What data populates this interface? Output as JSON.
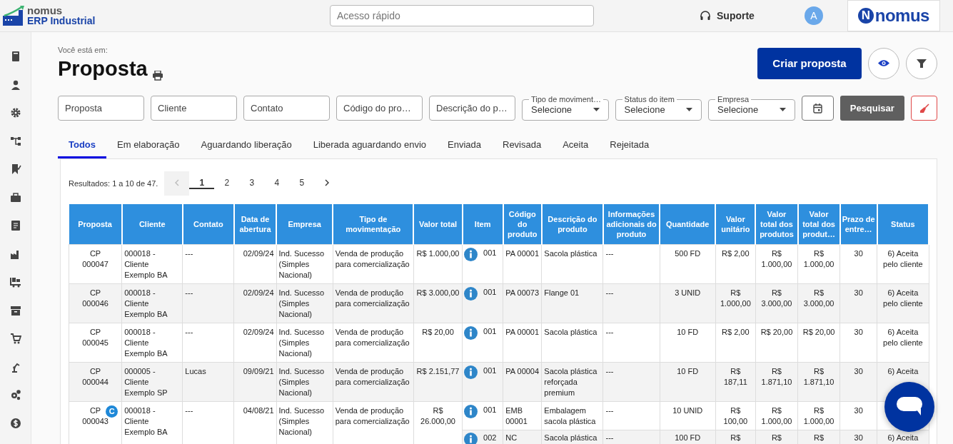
{
  "header": {
    "logo_line1": "nomus",
    "logo_line2": "ERP Industrial",
    "quick_access": {
      "placeholder": "Acesso rápido"
    },
    "support": "Suporte",
    "avatar": "A",
    "brand_mark": "N",
    "brand_name": "nomus"
  },
  "page": {
    "breadcrumb": "Você está em:",
    "title": "Proposta",
    "create_button": "Criar proposta"
  },
  "filters": [
    {
      "kind": "text",
      "placeholder": "Proposta"
    },
    {
      "kind": "text",
      "placeholder": "Cliente"
    },
    {
      "kind": "text",
      "placeholder": "Contato"
    },
    {
      "kind": "text",
      "placeholder": "Código do pro…"
    },
    {
      "kind": "text",
      "placeholder": "Descrição do p…"
    },
    {
      "kind": "select",
      "label": "Tipo de moviment…",
      "value": "Selecione"
    },
    {
      "kind": "select",
      "label": "Status do item",
      "value": "Selecione"
    },
    {
      "kind": "select",
      "label": "Empresa",
      "value": "Selecione"
    }
  ],
  "search_button": "Pesquisar",
  "tabs": [
    {
      "label": "Todos",
      "selected": true
    },
    {
      "label": "Em elaboração",
      "selected": false
    },
    {
      "label": "Aguardando liberação",
      "selected": false
    },
    {
      "label": "Liberada aguardando envio",
      "selected": false
    },
    {
      "label": "Enviada",
      "selected": false
    },
    {
      "label": "Revisada",
      "selected": false
    },
    {
      "label": "Aceita",
      "selected": false
    },
    {
      "label": "Rejeitada",
      "selected": false
    }
  ],
  "results": "Resultados: 1 a 10 de 47.",
  "pagination": {
    "prev_disabled": true,
    "pages": [
      {
        "label": "1",
        "selected": true
      },
      {
        "label": "2",
        "selected": false
      },
      {
        "label": "3",
        "selected": false
      },
      {
        "label": "4",
        "selected": false
      },
      {
        "label": "5",
        "selected": false
      }
    ]
  },
  "table": {
    "columns": [
      "Proposta",
      "Cliente",
      "Contato",
      "Data de abertura",
      "Empresa",
      "Tipo de movimentação",
      "Valor total",
      "Item",
      "Código do produto",
      "Descrição do produto",
      "Informações adicionais do produto",
      "Quantidade",
      "Valor unitário",
      "Valor total dos produtos",
      "Valor total dos produt…",
      "Prazo de entre…",
      "Status"
    ],
    "rows": [
      {
        "kind": "order",
        "proposta": "CP 000047",
        "cells": [
          "000018 - Cliente Exemplo BA",
          "---",
          "02/09/24",
          "Ind. Sucesso (Simples Nacional)",
          "Venda de produção para comercialização",
          "R$ 1.000,00"
        ],
        "item": [
          "001",
          "PA 00001",
          "Sacola plástica",
          "---",
          "500 FD",
          "R$ 2,00",
          "R$ 1.000,00",
          "R$ 1.000,00",
          "30",
          "6) Aceita pelo cliente"
        ]
      },
      {
        "kind": "order",
        "proposta": "CP 000046",
        "cells": [
          "000018 - Cliente Exemplo BA",
          "---",
          "02/09/24",
          "Ind. Sucesso (Simples Nacional)",
          "Venda de produção para comercialização",
          "R$ 3.000,00"
        ],
        "item": [
          "001",
          "PA 00073",
          "Flange 01",
          "---",
          "3 UNID",
          "R$ 1.000,00",
          "R$ 3.000,00",
          "R$ 3.000,00",
          "30",
          "6) Aceita pelo cliente"
        ]
      },
      {
        "kind": "order",
        "proposta": "CP 000045",
        "cells": [
          "000018 - Cliente Exemplo BA",
          "---",
          "02/09/24",
          "Ind. Sucesso (Simples Nacional)",
          "Venda de produção para comercialização",
          "R$ 20,00"
        ],
        "item": [
          "001",
          "PA 00001",
          "Sacola plástica",
          "---",
          "10 FD",
          "R$ 2,00",
          "R$ 20,00",
          "R$ 20,00",
          "30",
          "6) Aceita pelo cliente"
        ]
      },
      {
        "kind": "order",
        "proposta": "CP 000044",
        "cells": [
          "000005 - Cliente Exemplo SP",
          "Lucas",
          "09/09/21",
          "Ind. Sucesso (Simples Nacional)",
          "Venda de produção para comercialização",
          "R$ 2.151,77"
        ],
        "item": [
          "001",
          "PA 00004",
          "Sacola plástica reforçada premium",
          "---",
          "10 FD",
          "R$ 187,11",
          "R$ 1.871,10",
          "R$ 1.871,10",
          "30",
          "6) Aceita"
        ]
      },
      {
        "kind": "order",
        "proposta": "CP 000043",
        "badge": "C",
        "cells": [
          "000018 - Cliente Exemplo BA",
          "---",
          "04/08/21",
          "Ind. Sucesso (Simples Nacional)",
          "Venda de produção para comercialização",
          "R$ 26.000,00"
        ],
        "item": [
          "001",
          "EMB 00001",
          "Embalagem sacola plástica",
          "---",
          "10 UNID",
          "R$ 100,00",
          "R$ 1.000,00",
          "R$ 1.000,00",
          "30"
        ]
      },
      {
        "kind": "sub-item",
        "item": [
          "002",
          "NC",
          "Sacola plástica",
          "---",
          "100 FD",
          "R$",
          "R$",
          "R$",
          "30",
          "6) Aceita"
        ]
      }
    ]
  }
}
